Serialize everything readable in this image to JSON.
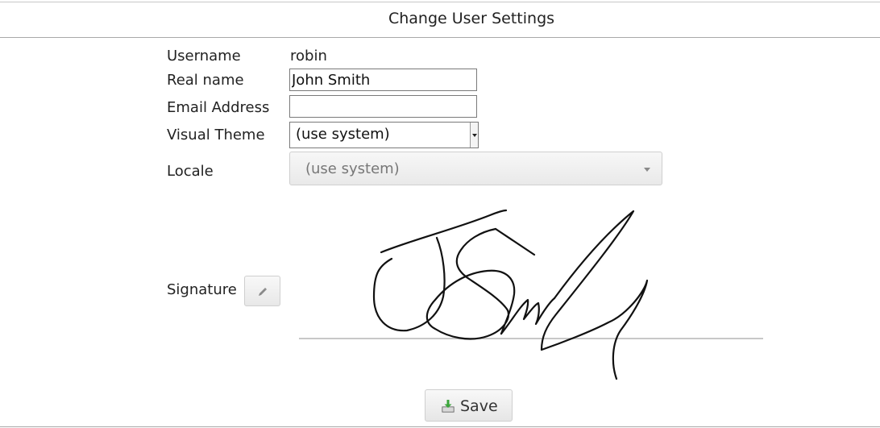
{
  "header": {
    "title": "Change User Settings"
  },
  "form": {
    "username_label": "Username",
    "username_value": "robin",
    "realname_label": "Real name",
    "realname_value": "John Smith",
    "email_label": "Email Address",
    "email_value": "",
    "theme_label": "Visual Theme",
    "theme_selected": "(use system)",
    "locale_label": "Locale",
    "locale_selected": "(use system)",
    "signature_label": "Signature"
  },
  "icons": {
    "edit_signature": "pencil-icon",
    "save": "save-download-icon"
  },
  "actions": {
    "save_label": "Save"
  }
}
